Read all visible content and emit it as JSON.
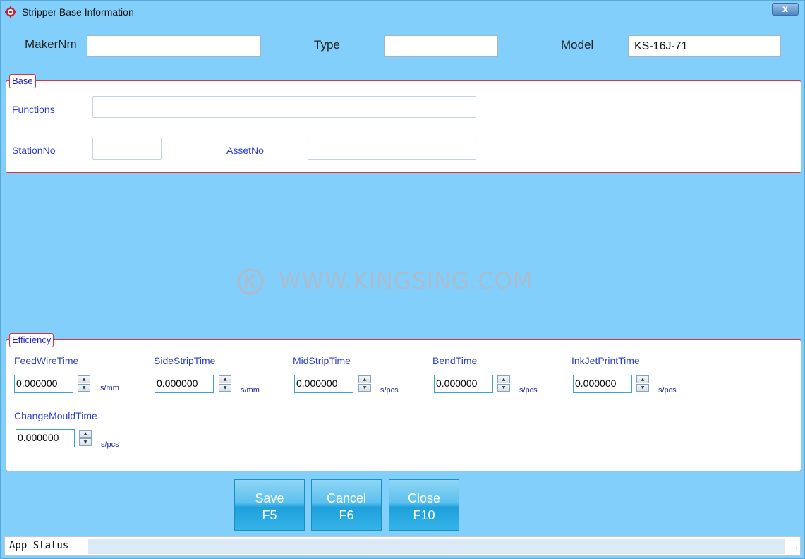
{
  "window": {
    "title": "Stripper Base Information",
    "close_label": "x"
  },
  "header": {
    "makernm_label": "MakerNm",
    "makernm_value": "",
    "type_label": "Type",
    "type_value": "",
    "model_label": "Model",
    "model_value": "KS-16J-71"
  },
  "base": {
    "title": "Base",
    "functions_label": "Functions",
    "functions_value": "",
    "stationno_label": "StationNo",
    "stationno_value": "",
    "assetno_label": "AssetNo",
    "assetno_value": ""
  },
  "watermark": {
    "text": "WWW.KINGSING.COM"
  },
  "efficiency": {
    "title": "Efficiency",
    "fields": [
      {
        "label": "FeedWireTime",
        "value": "0.000000",
        "unit": "s/mm"
      },
      {
        "label": "SideStripTime",
        "value": "0.000000",
        "unit": "s/mm"
      },
      {
        "label": "MidStripTime",
        "value": "0.000000",
        "unit": "s/pcs"
      },
      {
        "label": "BendTime",
        "value": "0.000000",
        "unit": "s/pcs"
      },
      {
        "label": "InkJetPrintTime",
        "value": "0.000000",
        "unit": "s/pcs"
      },
      {
        "label": "ChangeMouldTime",
        "value": "0.000000",
        "unit": "s/pcs"
      }
    ]
  },
  "buttons": {
    "save": {
      "label": "Save",
      "key": "F5"
    },
    "cancel": {
      "label": "Cancel",
      "key": "F6"
    },
    "close": {
      "label": "Close",
      "key": "F10"
    }
  },
  "status": {
    "text": "App Status"
  },
  "colors": {
    "background": "#81cffa",
    "group_border": "#e0303a",
    "label_blue": "#2a3fd0"
  }
}
